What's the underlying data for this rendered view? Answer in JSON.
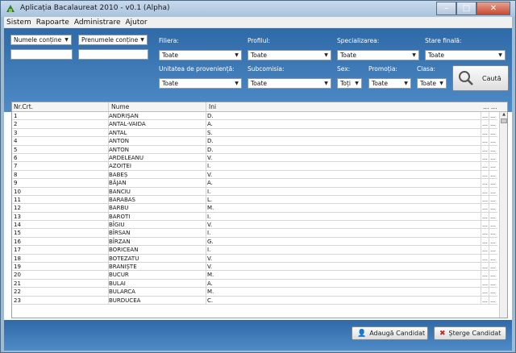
{
  "window": {
    "title": "Aplicația Bacalaureat 2010 - v0.1 (Alpha)",
    "min": "–",
    "max": "□",
    "close": "✕"
  },
  "menu": [
    "Sistem",
    "Rapoarte",
    "Administrare",
    "Ajutor"
  ],
  "filters": {
    "nume_combo": "Numele conține",
    "prenume_combo": "Prenumele conține",
    "labels": {
      "filiera": "Filiera:",
      "profilul": "Profilul:",
      "specializarea": "Specializarea:",
      "stare_finala": "Stare finală:",
      "unitatea": "Unitatea de proveniență:",
      "subcomisia": "Subcomisia:",
      "sex": "Sex:",
      "promotia": "Promoția:",
      "clasa": "Clasa:"
    },
    "values": {
      "filiera": "Toate",
      "profilul": "Toate",
      "specializarea": "Toate",
      "stare_finala": "Toate",
      "unitatea": "Toate",
      "subcomisia": "Toate",
      "sex": "Toți",
      "promotia": "Toate",
      "clasa": "Toate"
    },
    "search_label": "Caută"
  },
  "grid": {
    "headers": [
      "Nr.Crt.",
      "Nume",
      "Ini"
    ],
    "rows": [
      [
        "1",
        "ANDRIȘAN",
        "D."
      ],
      [
        "2",
        "ANTAL-VAIDA",
        "A."
      ],
      [
        "3",
        "ANTAL",
        "S."
      ],
      [
        "4",
        "ANTON",
        "D."
      ],
      [
        "5",
        "ANTON",
        "D."
      ],
      [
        "6",
        "ARDELEANU",
        "V."
      ],
      [
        "7",
        "AZOIȚEI",
        "I."
      ],
      [
        "8",
        "BABEȘ",
        "V."
      ],
      [
        "9",
        "BĂJAN",
        "A."
      ],
      [
        "10",
        "BANCIU",
        "I."
      ],
      [
        "11",
        "BARABAS",
        "L."
      ],
      [
        "12",
        "BARBU",
        "M."
      ],
      [
        "13",
        "BAROTI",
        "I."
      ],
      [
        "14",
        "BÎGIU",
        "V."
      ],
      [
        "15",
        "BÎRSAN",
        "I."
      ],
      [
        "16",
        "BÎRZAN",
        "G."
      ],
      [
        "17",
        "BORICEAN",
        "I."
      ],
      [
        "18",
        "BOTEZATU",
        "V."
      ],
      [
        "19",
        "BRANIȘTE",
        "V."
      ],
      [
        "20",
        "BUCUR",
        "M."
      ],
      [
        "21",
        "BULAI",
        "A."
      ],
      [
        "22",
        "BULARCA",
        "M."
      ],
      [
        "23",
        "BURDUCEA",
        "C."
      ]
    ]
  },
  "buttons": {
    "add": "Adaugă Candidat",
    "delete": "Șterge Candidat"
  }
}
